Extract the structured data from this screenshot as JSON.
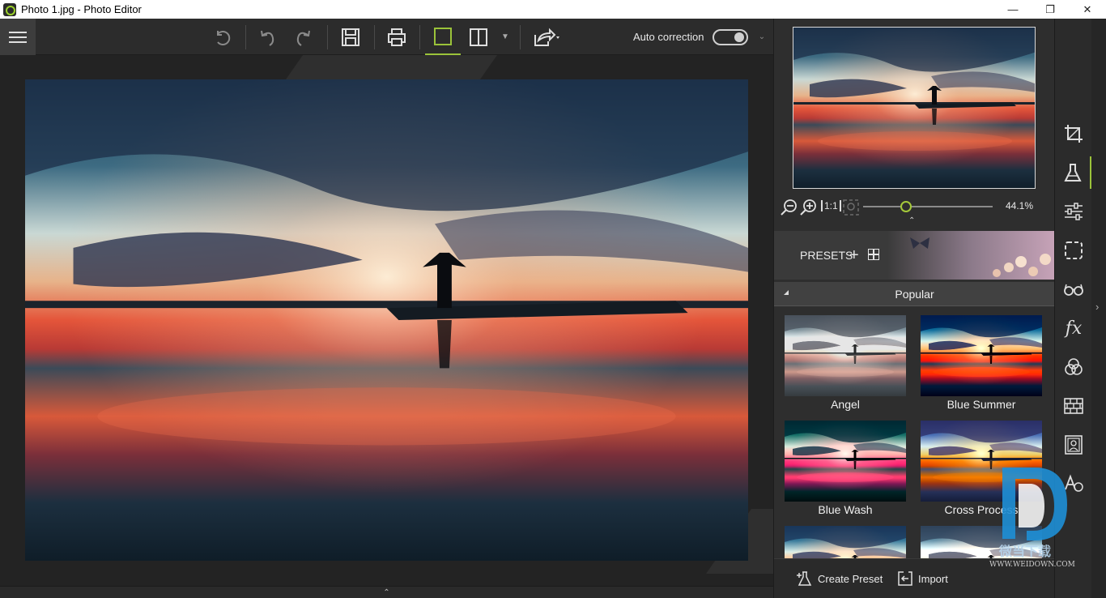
{
  "window": {
    "title": "Photo 1.jpg - Photo Editor",
    "controls": {
      "minimize": "—",
      "maximize": "❐",
      "close": "✕"
    }
  },
  "toolbar": {
    "menu_icon": "hamburger-icon",
    "buttons": [
      {
        "name": "rotate-left",
        "icon": "rotate-left-icon"
      },
      {
        "name": "undo",
        "icon": "undo-icon"
      },
      {
        "name": "redo",
        "icon": "redo-icon"
      },
      {
        "name": "save",
        "icon": "save-icon"
      },
      {
        "name": "print",
        "icon": "print-icon"
      },
      {
        "name": "single-view",
        "icon": "square-icon",
        "active": true
      },
      {
        "name": "compare-view",
        "icon": "split-view-icon"
      },
      {
        "name": "share",
        "icon": "share-icon"
      }
    ],
    "auto_correction_label": "Auto correction",
    "auto_correction_on": false
  },
  "navigator": {
    "zoom_value": "44.1%",
    "zoom_fraction": 0.33,
    "one_to_one_label": "1:1"
  },
  "presets": {
    "header_label": "PRESETS",
    "category": "Popular",
    "items": [
      {
        "label": "Angel",
        "style": "angel"
      },
      {
        "label": "Blue Summer",
        "style": "bluesummer"
      },
      {
        "label": "Blue Wash",
        "style": "bluewash"
      },
      {
        "label": "Cross Process",
        "style": "cross"
      },
      {
        "label": "",
        "style": "p5"
      },
      {
        "label": "",
        "style": "p6"
      }
    ],
    "create_label": "Create Preset",
    "import_label": "Import"
  },
  "tools": [
    {
      "name": "crop",
      "icon": "crop-icon"
    },
    {
      "name": "effects",
      "icon": "flask-icon",
      "active": true
    },
    {
      "name": "adjust",
      "icon": "sliders-icon"
    },
    {
      "name": "selection",
      "icon": "dashed-square-icon"
    },
    {
      "name": "retouch",
      "icon": "glasses-icon"
    },
    {
      "name": "fx",
      "icon": "fx-icon"
    },
    {
      "name": "color",
      "icon": "circles-icon"
    },
    {
      "name": "texture",
      "icon": "bricks-icon"
    },
    {
      "name": "frame",
      "icon": "portrait-frame-icon"
    },
    {
      "name": "text",
      "icon": "text-icon"
    }
  ],
  "watermark": {
    "cn_text": "微当下载",
    "url": "WWW.WEIDOWN.COM"
  }
}
